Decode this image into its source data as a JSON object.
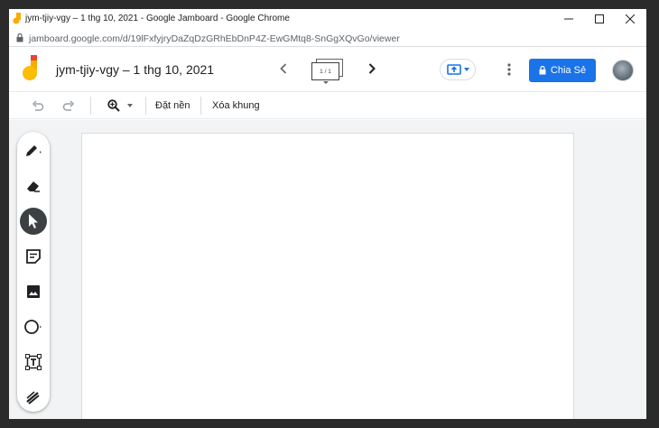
{
  "window": {
    "title": "jym-tjiy-vgy – 1 thg 10, 2021 - Google Jamboard - Google Chrome",
    "url": "jamboard.google.com/d/19lFxfyjryDaZqDzGRhEbDnP4Z-EwGMtq8-SnGgXQvGo/viewer"
  },
  "app": {
    "doc_title": "jym-tjiy-vgy – 1 thg 10, 2021",
    "frame_indicator": "1 / 1",
    "share_label": "Chia Sẻ",
    "accent_color": "#1a73e8"
  },
  "toolbar": {
    "set_background": "Đặt nền",
    "clear_frame": "Xóa khung"
  },
  "tools": [
    {
      "name": "pen",
      "icon": "pen-icon"
    },
    {
      "name": "eraser",
      "icon": "eraser-icon"
    },
    {
      "name": "select",
      "icon": "cursor-icon",
      "active": true
    },
    {
      "name": "sticky-note",
      "icon": "sticky-note-icon"
    },
    {
      "name": "image",
      "icon": "image-icon"
    },
    {
      "name": "shape",
      "icon": "circle-icon"
    },
    {
      "name": "text-box",
      "icon": "text-box-icon"
    },
    {
      "name": "laser",
      "icon": "laser-icon"
    }
  ]
}
